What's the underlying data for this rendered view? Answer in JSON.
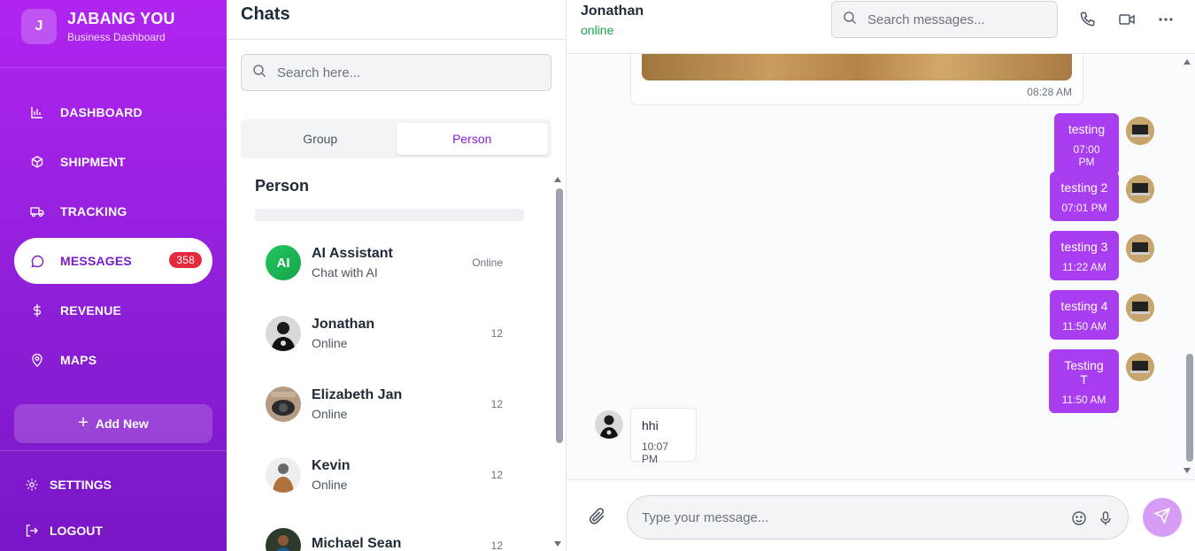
{
  "brand": {
    "logo_letter": "J",
    "name": "JABANG YOU",
    "subtitle": "Business Dashboard"
  },
  "nav": [
    {
      "label": "DASHBOARD",
      "icon": "bar-chart-icon"
    },
    {
      "label": "SHIPMENT",
      "icon": "box-icon"
    },
    {
      "label": "TRACKING",
      "icon": "truck-icon"
    },
    {
      "label": "MESSAGES",
      "icon": "message-icon",
      "badge": "358",
      "active": true
    },
    {
      "label": "REVENUE",
      "icon": "dollar-icon"
    },
    {
      "label": "MAPS",
      "icon": "map-pin-icon"
    }
  ],
  "add_new": {
    "label": "Add New"
  },
  "bottom": {
    "settings": "SETTINGS",
    "logout": "LOGOUT"
  },
  "chatlist": {
    "title": "Chats",
    "search_placeholder": "Search here...",
    "tabs": [
      "Group",
      "Person"
    ],
    "active_tab": "Person",
    "section_label": "Person",
    "contacts": [
      {
        "name": "AI Assistant",
        "sub": "Chat with AI",
        "meta": "Online",
        "avatar_text": "AI"
      },
      {
        "name": "Jonathan",
        "sub": "Online",
        "meta": "12"
      },
      {
        "name": "Elizabeth Jan",
        "sub": "Online",
        "meta": "12"
      },
      {
        "name": "Kevin",
        "sub": "Online",
        "meta": "12"
      },
      {
        "name": "Michael Sean",
        "sub": "",
        "meta": "12"
      }
    ]
  },
  "conversation": {
    "peer_name": "Jonathan",
    "peer_status": "online",
    "search_placeholder": "Search messages...",
    "image_time": "08:28 AM",
    "outgoing": [
      {
        "text": "testing",
        "time": "07:00 PM"
      },
      {
        "text": "testing 2",
        "time": "07:01 PM"
      },
      {
        "text": "testing 3",
        "time": "11:22 AM"
      },
      {
        "text": "testing 4",
        "time": "11:50 AM"
      },
      {
        "text": "Testing T",
        "time": "11:50 AM"
      }
    ],
    "incoming": {
      "text": "hhi",
      "time": "10:07 PM"
    },
    "composer_placeholder": "Type your message..."
  },
  "colors": {
    "accent": "#a93ef0",
    "sidebar_top": "#b024f0",
    "badge": "#e5293b",
    "online": "#16a34a"
  }
}
